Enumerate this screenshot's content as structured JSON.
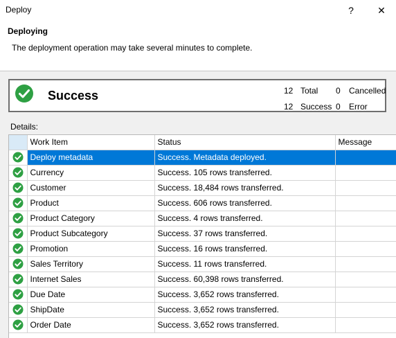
{
  "window": {
    "title": "Deploy",
    "help_glyph": "?",
    "close_glyph": "✕"
  },
  "header": {
    "title": "Deploying",
    "description": "The deployment operation may take several minutes to complete."
  },
  "summary": {
    "result": "Success",
    "total_count": "12",
    "total_label": "Total",
    "success_count": "12",
    "success_label": "Success",
    "cancelled_count": "0",
    "cancelled_label": "Cancelled",
    "error_count": "0",
    "error_label": "Error"
  },
  "details": {
    "label": "Details:",
    "columns": [
      "Work Item",
      "Status",
      "Message"
    ],
    "rows": [
      {
        "work_item": "Deploy metadata",
        "status": "Success. Metadata deployed.",
        "message": ""
      },
      {
        "work_item": "Currency",
        "status": "Success. 105 rows transferred.",
        "message": ""
      },
      {
        "work_item": "Customer",
        "status": "Success. 18,484 rows transferred.",
        "message": ""
      },
      {
        "work_item": "Product",
        "status": "Success. 606 rows transferred.",
        "message": ""
      },
      {
        "work_item": "Product Category",
        "status": "Success. 4 rows transferred.",
        "message": ""
      },
      {
        "work_item": "Product Subcategory",
        "status": "Success. 37 rows transferred.",
        "message": ""
      },
      {
        "work_item": "Promotion",
        "status": "Success. 16 rows transferred.",
        "message": ""
      },
      {
        "work_item": "Sales Territory",
        "status": "Success. 11 rows transferred.",
        "message": ""
      },
      {
        "work_item": "Internet Sales",
        "status": "Success. 60,398 rows transferred.",
        "message": ""
      },
      {
        "work_item": "Due Date",
        "status": "Success. 3,652 rows transferred.",
        "message": ""
      },
      {
        "work_item": "ShipDate",
        "status": "Success. 3,652 rows transferred.",
        "message": ""
      },
      {
        "work_item": "Order Date",
        "status": "Success. 3,652 rows transferred.",
        "message": ""
      }
    ],
    "selected_row": 0
  },
  "icons": {
    "row_status": "success-check-icon",
    "summary_status": "success-check-icon"
  },
  "colors": {
    "success_green": "#2ea043",
    "selection": "#0078d7"
  }
}
